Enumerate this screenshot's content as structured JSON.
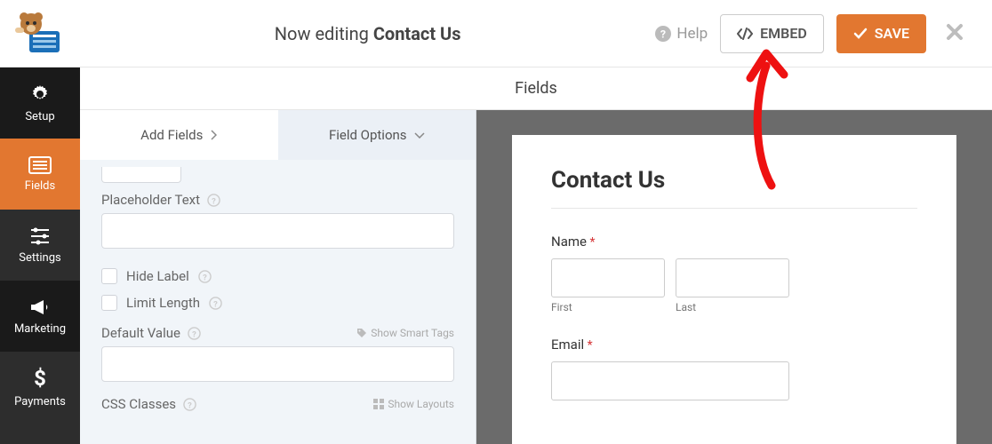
{
  "header": {
    "editing_prefix": "Now editing ",
    "form_name": "Contact Us",
    "help_label": "Help",
    "embed_label": "EMBED",
    "save_label": "SAVE"
  },
  "sidebar": {
    "items": [
      {
        "label": "Setup"
      },
      {
        "label": "Fields"
      },
      {
        "label": "Settings"
      },
      {
        "label": "Marketing"
      },
      {
        "label": "Payments"
      }
    ]
  },
  "panel_title": "Fields",
  "tabs": {
    "add_fields": "Add Fields",
    "field_options": "Field Options"
  },
  "options": {
    "placeholder_text_label": "Placeholder Text",
    "hide_label": "Hide Label",
    "limit_length": "Limit Length",
    "default_value_label": "Default Value",
    "smart_tags": "Show Smart Tags",
    "css_classes_label": "CSS Classes",
    "show_layouts": "Show Layouts"
  },
  "preview": {
    "title": "Contact Us",
    "name_label": "Name",
    "first": "First",
    "last": "Last",
    "email_label": "Email"
  }
}
